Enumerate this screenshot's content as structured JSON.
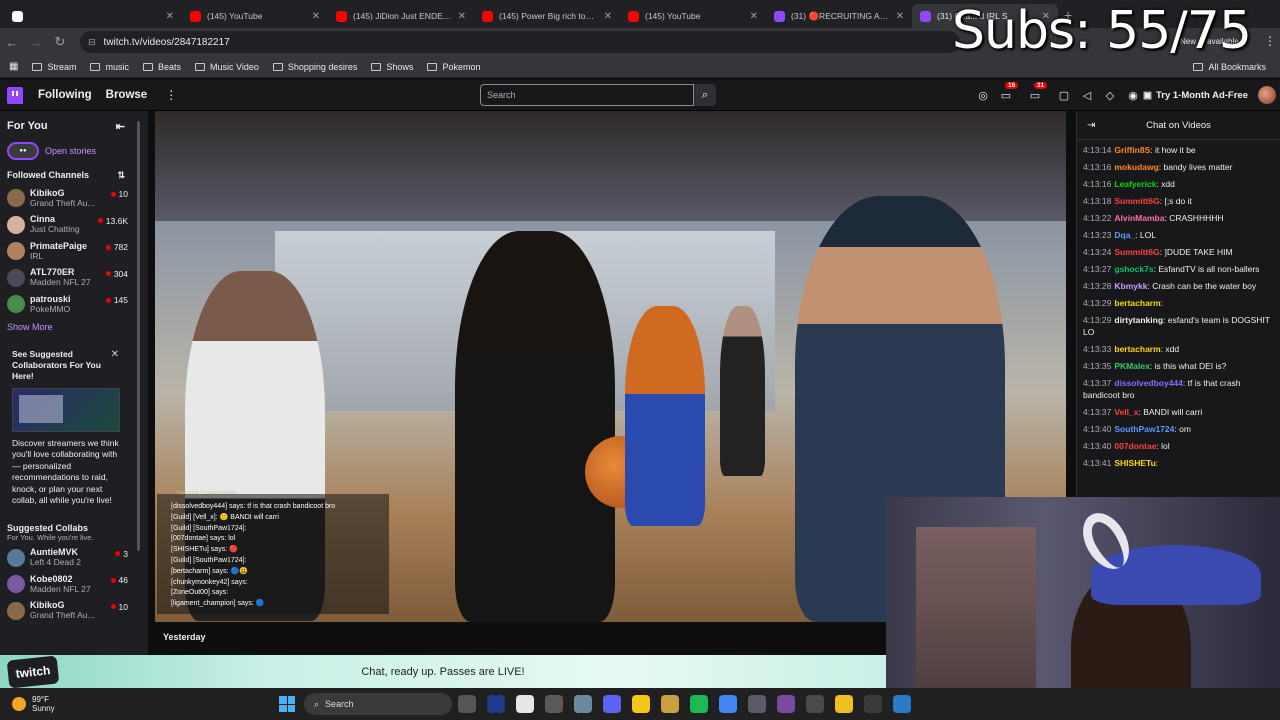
{
  "browser": {
    "tabs": [
      {
        "label": "",
        "color": "#ffffff"
      },
      {
        "label": "(145) YouTube",
        "color": "#ff0000"
      },
      {
        "label": "(145) JiDion Just ENDED Hi",
        "color": "#ff0000"
      },
      {
        "label": "(145) Power Big rich town(",
        "color": "#ff0000"
      },
      {
        "label": "(145) YouTube",
        "color": "#ff0000"
      },
      {
        "label": "(31) 🔴RECRUITING AUSTI",
        "color": "#9147ff"
      },
      {
        "label": "(31) Coa... d IRL S",
        "color": "#9147ff"
      }
    ],
    "new_tab": "+",
    "url": "twitch.tv/videos/2847182217",
    "update_label": "New ... available",
    "bookmarks": [
      "Stream",
      "music",
      "Beats",
      "Music Video",
      "Shopping desires",
      "Shows",
      "Pokemon"
    ],
    "all_bookmarks": "All Bookmarks"
  },
  "overlay": {
    "subs": "Subs: 55/75"
  },
  "twitch": {
    "following": "Following",
    "browse": "Browse",
    "search_placeholder": "Search",
    "notif_count_1": "16",
    "notif_count_2": "31",
    "ad_free": "Try 1-Month Ad-Free",
    "accent": "#9147ff"
  },
  "sidebar": {
    "for_you": "For You",
    "open_stories": "Open stories",
    "followed_channels": "Followed Channels",
    "channels": [
      {
        "name": "KibikoG",
        "game": "Grand Theft Au...",
        "viewers": "10",
        "color": "#8a6a4a"
      },
      {
        "name": "Cinna",
        "game": "Just Chatting",
        "viewers": "13.6K",
        "color": "#d8b0a0"
      },
      {
        "name": "PrimatePaige",
        "game": "IRL",
        "viewers": "782",
        "color": "#b08060"
      },
      {
        "name": "ATL770ER",
        "game": "Madden NFL 27",
        "viewers": "304",
        "color": "#4a4a5a"
      },
      {
        "name": "patrouski",
        "game": "PokeMMO",
        "viewers": "145",
        "color": "#4a8a4a"
      }
    ],
    "show_more": "Show More",
    "suggest_title": "See Suggested Collaborators For You Here!",
    "suggest_desc": "Discover streamers we think you'll love collaborating with — personalized recommendations to raid, knock, or plan your next collab, all while you're live!",
    "suggested_collabs": "Suggested Collabs",
    "suggested_sub": "For You. While you're live.",
    "collabs": [
      {
        "name": "AuntieMVK",
        "game": "Left 4 Dead 2",
        "viewers": "3",
        "color": "#5a7a9a"
      },
      {
        "name": "Kobe0802",
        "game": "Madden NFL 27",
        "viewers": "46",
        "color": "#7a5aa0"
      },
      {
        "name": "KibikoG",
        "game": "Grand Theft Au...",
        "viewers": "10",
        "color": "#8a6a4a"
      }
    ]
  },
  "video_overlay_chat": {
    "tabs": "General   Conversation",
    "lines": [
      "[dissolvedboy444] says: tf is that crash bandicoot bro",
      "[Guild] [Vell_x]: 🙂 BANDI will carri",
      "[Guild] [SouthPaw1724]:",
      "[007dontae] says: lol",
      "[SHISHETu] says: 🔴",
      "[Guild] [SouthPaw1724]:",
      "[bertacharm] says: 🔵😃",
      "[chunkymonkey42] says:",
      "[ZoneOut00] says:",
      "[ligament_champion] says: 🔵"
    ]
  },
  "below_video": {
    "yesterday": "Yesterday"
  },
  "banner": {
    "text": "Chat, ready up. Passes are LIVE!",
    "badge": "twitch"
  },
  "chat": {
    "title": "Chat on Videos",
    "messages": [
      {
        "time": "4:13:14",
        "user": "Griffin8S",
        "color": "#ff8a1c",
        "text": "it how it be"
      },
      {
        "time": "4:13:16",
        "user": "mokudawg",
        "color": "#ff8a1c",
        "text": "bandy lives matter"
      },
      {
        "time": "4:13:16",
        "user": "Leafyerick",
        "color": "#00d900",
        "text": "xdd"
      },
      {
        "time": "4:13:18",
        "user": "Summitt6G",
        "color": "#ff4040",
        "text": "[;s do it"
      },
      {
        "time": "4:13:22",
        "user": "AlvinMamba",
        "color": "#ff6ea8",
        "text": "CRASHHHHH"
      },
      {
        "time": "4:13:23",
        "user": "Dqa_",
        "color": "#5a9cff",
        "text": "LOL"
      },
      {
        "time": "4:13:24",
        "user": "Summitt6G",
        "color": "#ff4040",
        "text": "]DUDE TAKE HIM"
      },
      {
        "time": "4:13:27",
        "user": "gshock7s",
        "color": "#00c36a",
        "text": "EsfandTV is all non-ballers"
      },
      {
        "time": "4:13:28",
        "user": "Kbmykk",
        "color": "#c8a0ff",
        "text": "Crash can be the water boy"
      },
      {
        "time": "4:13:29",
        "user": "bertacharm",
        "color": "#ffd700",
        "text": ""
      },
      {
        "time": "4:13:29",
        "user": "dirtytanking",
        "color": "#efeff1",
        "text": "esfand's team is DOGSHIT LO"
      },
      {
        "time": "4:13:33",
        "user": "bertacharm",
        "color": "#ffd700",
        "text": "xdd"
      },
      {
        "time": "4:13:35",
        "user": "PKMalex",
        "color": "#2ecc71",
        "text": "is this what DEI is?"
      },
      {
        "time": "4:13:37",
        "user": "dissolvedboy444",
        "color": "#8a6aff",
        "text": "tf is that crash bandicoot bro"
      },
      {
        "time": "4:13:37",
        "user": "Vell_x",
        "color": "#ff4040",
        "text": "BANDI will carri"
      },
      {
        "time": "4:13:40",
        "user": "SouthPaw1724",
        "color": "#5a9cff",
        "text": "om"
      },
      {
        "time": "4:13:40",
        "user": "007dontae",
        "color": "#ff4040",
        "text": "lol"
      },
      {
        "time": "4:13:41",
        "user": "SHISHETu",
        "color": "#ffd700",
        "text": ""
      }
    ]
  },
  "taskbar": {
    "temp": "99°F",
    "condition": "Sunny",
    "search": "Search",
    "apps": [
      "#555",
      "#1e3a8a",
      "#e6e6e6",
      "#5a5a5a",
      "#6a8aa0",
      "#5865f2",
      "#f5c518",
      "#c8a040",
      "#1db954",
      "#4285f4",
      "#5a5a6a",
      "#7a4aa0",
      "#4a4a4a",
      "#f0c020",
      "#3a3a3a",
      "#2a7ac8"
    ]
  }
}
